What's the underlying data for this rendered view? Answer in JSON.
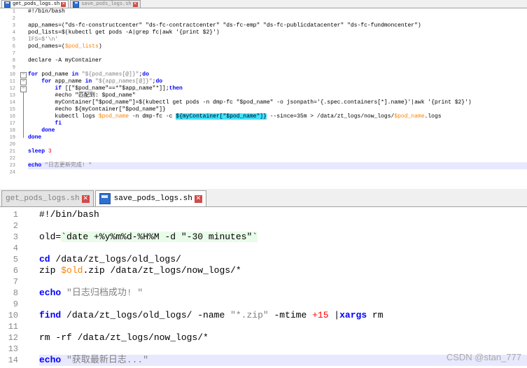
{
  "top_panel": {
    "tabs": [
      {
        "label": "get_pods_logs.sh",
        "active": true
      },
      {
        "label": "save_pods_logs.sh",
        "active": false
      }
    ],
    "lines": [
      {
        "num": "1",
        "fold": "",
        "tokens": [
          {
            "t": "#!/bin/bash"
          }
        ]
      },
      {
        "num": "2",
        "fold": "",
        "tokens": []
      },
      {
        "num": "3",
        "fold": "",
        "tokens": [
          {
            "t": "app_names=(\"ds-fc-constructcenter\" \"ds-fc-contractcenter\" \"ds-fc-emp\" \"ds-fc-publicdatacenter\" \"ds-fc-fundmoncenter\")"
          }
        ]
      },
      {
        "num": "4",
        "fold": "",
        "tokens": [
          {
            "t": "pod_lists=$(kubectl get pods -A|grep fc|awk '{print $2}')"
          }
        ]
      },
      {
        "num": "5",
        "fold": "",
        "tokens": [
          {
            "t": "IFS=$'\\n'",
            "c": "str"
          }
        ]
      },
      {
        "num": "6",
        "fold": "",
        "tokens": [
          {
            "t": "pod_names=("
          },
          {
            "t": "$pod_lists",
            "c": "var"
          },
          {
            "t": ")"
          }
        ]
      },
      {
        "num": "7",
        "fold": "",
        "tokens": []
      },
      {
        "num": "8",
        "fold": "",
        "tokens": [
          {
            "t": "declare -A myContainer"
          }
        ]
      },
      {
        "num": "9",
        "fold": "",
        "tokens": []
      },
      {
        "num": "10",
        "fold": "open",
        "tokens": [
          {
            "t": "for",
            "c": "kw"
          },
          {
            "t": " pod_name "
          },
          {
            "t": "in",
            "c": "kw"
          },
          {
            "t": " "
          },
          {
            "t": "\"${pod_names[@]}\"",
            "c": "str"
          },
          {
            "t": ";"
          },
          {
            "t": "do",
            "c": "kw"
          }
        ]
      },
      {
        "num": "11",
        "fold": "open",
        "tokens": [
          {
            "t": "    "
          },
          {
            "t": "for",
            "c": "kw"
          },
          {
            "t": " app_name "
          },
          {
            "t": "in",
            "c": "kw"
          },
          {
            "t": " "
          },
          {
            "t": "\"${app_names[@]}\"",
            "c": "str"
          },
          {
            "t": ";"
          },
          {
            "t": "do",
            "c": "kw"
          }
        ]
      },
      {
        "num": "12",
        "fold": "open",
        "tokens": [
          {
            "t": "        "
          },
          {
            "t": "if",
            "c": "kw"
          },
          {
            "t": " [[\"$pod_name\"==*\"$app_name\"*]];"
          },
          {
            "t": "then",
            "c": "kw"
          }
        ]
      },
      {
        "num": "13",
        "fold": "line",
        "tokens": [
          {
            "t": "        #echo \"匹配到: $pod_name\""
          }
        ]
      },
      {
        "num": "14",
        "fold": "line",
        "tokens": [
          {
            "t": "        myContainer[\"$pod_name\"]=$(kubectl get pods -n dmp-fc \"$pod_name\" -o jsonpath='{.spec.containers[*].name}'|awk '{print $2}')"
          }
        ]
      },
      {
        "num": "15",
        "fold": "line",
        "tokens": [
          {
            "t": "        #echo ${myContainer[\"$pod_name\"]}"
          }
        ]
      },
      {
        "num": "16",
        "fold": "line",
        "tokens": [
          {
            "t": "        kubectl logs "
          },
          {
            "t": "$pod_name",
            "c": "var"
          },
          {
            "t": " -n dmp-fc -c "
          },
          {
            "t": "${myContainer[\"$pod_name\"]}",
            "c": "hl"
          },
          {
            "t": " --since=35m > /data/zt_logs/now_logs/"
          },
          {
            "t": "$pod_name",
            "c": "var"
          },
          {
            "t": ".logs"
          }
        ]
      },
      {
        "num": "17",
        "fold": "line",
        "tokens": [
          {
            "t": "        "
          },
          {
            "t": "fi",
            "c": "kw"
          }
        ]
      },
      {
        "num": "18",
        "fold": "line",
        "tokens": [
          {
            "t": "    "
          },
          {
            "t": "done",
            "c": "kw"
          }
        ]
      },
      {
        "num": "19",
        "fold": "end",
        "tokens": [
          {
            "t": "done",
            "c": "kw"
          }
        ]
      },
      {
        "num": "20",
        "fold": "",
        "tokens": []
      },
      {
        "num": "21",
        "fold": "",
        "tokens": [
          {
            "t": "sleep",
            "c": "kw"
          },
          {
            "t": " "
          },
          {
            "t": "3",
            "c": "num"
          }
        ]
      },
      {
        "num": "22",
        "fold": "",
        "tokens": []
      },
      {
        "num": "23",
        "fold": "",
        "current": true,
        "tokens": [
          {
            "t": "echo",
            "c": "kw"
          },
          {
            "t": " "
          },
          {
            "t": "\"日志更新完成! \"",
            "c": "str"
          }
        ]
      },
      {
        "num": "24",
        "fold": "",
        "tokens": []
      }
    ]
  },
  "bottom_panel": {
    "tabs": [
      {
        "label": "get_pods_logs.sh",
        "active": false
      },
      {
        "label": "save_pods_logs.sh",
        "active": true
      }
    ],
    "lines": [
      {
        "num": "1",
        "tokens": [
          {
            "t": "#!/bin/bash"
          }
        ]
      },
      {
        "num": "2",
        "tokens": []
      },
      {
        "num": "3",
        "tokens": [
          {
            "t": "old="
          },
          {
            "t": "`date +%y%m%d-%H%M -d \"-30 minutes\"`",
            "c": "bt"
          }
        ]
      },
      {
        "num": "4",
        "tokens": []
      },
      {
        "num": "5",
        "tokens": [
          {
            "t": "cd",
            "c": "kw"
          },
          {
            "t": " /data/zt_logs/old_logs/"
          }
        ]
      },
      {
        "num": "6",
        "tokens": [
          {
            "t": "zip "
          },
          {
            "t": "$old",
            "c": "var"
          },
          {
            "t": ".zip /data/zt_logs/now_logs/*"
          }
        ]
      },
      {
        "num": "7",
        "tokens": []
      },
      {
        "num": "8",
        "tokens": [
          {
            "t": "echo",
            "c": "kw"
          },
          {
            "t": " "
          },
          {
            "t": "\"日志归档成功! \"",
            "c": "str"
          }
        ]
      },
      {
        "num": "9",
        "tokens": []
      },
      {
        "num": "10",
        "tokens": [
          {
            "t": "find",
            "c": "kw"
          },
          {
            "t": " /data/zt_logs/old_logs/ -name "
          },
          {
            "t": "\"*.zip\"",
            "c": "str"
          },
          {
            "t": " -mtime "
          },
          {
            "t": "+15",
            "c": "num"
          },
          {
            "t": " |"
          },
          {
            "t": "xargs",
            "c": "kw"
          },
          {
            "t": " rm"
          }
        ]
      },
      {
        "num": "11",
        "tokens": []
      },
      {
        "num": "12",
        "tokens": [
          {
            "t": "rm -rf /data/zt_logs/now_logs/*"
          }
        ]
      },
      {
        "num": "13",
        "tokens": []
      },
      {
        "num": "14",
        "current": true,
        "tokens": [
          {
            "t": "echo",
            "c": "kw"
          },
          {
            "t": " "
          },
          {
            "t": "\"获取最新日志...\"",
            "c": "str"
          }
        ]
      }
    ]
  },
  "watermark": "CSDN @stan_777"
}
